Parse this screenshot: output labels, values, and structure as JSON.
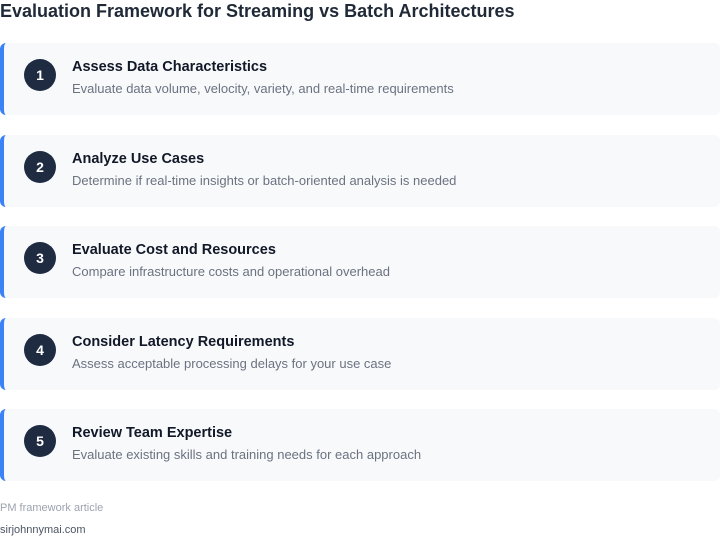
{
  "title": "Evaluation Framework for Streaming vs Batch Architectures",
  "accent_color": "#3b82f6",
  "badge_color": "#1f2b40",
  "steps": [
    {
      "number": "1",
      "title": "Assess Data Characteristics",
      "description": "Evaluate data volume, velocity, variety, and real-time requirements"
    },
    {
      "number": "2",
      "title": "Analyze Use Cases",
      "description": "Determine if real-time insights or batch-oriented analysis is needed"
    },
    {
      "number": "3",
      "title": "Evaluate Cost and Resources",
      "description": "Compare infrastructure costs and operational overhead"
    },
    {
      "number": "4",
      "title": "Consider Latency Requirements",
      "description": "Assess acceptable processing delays for your use case"
    },
    {
      "number": "5",
      "title": "Review Team Expertise",
      "description": "Evaluate existing skills and training needs for each approach"
    }
  ],
  "footer": {
    "note": "PM framework article",
    "site": "sirjohnnymai.com"
  }
}
